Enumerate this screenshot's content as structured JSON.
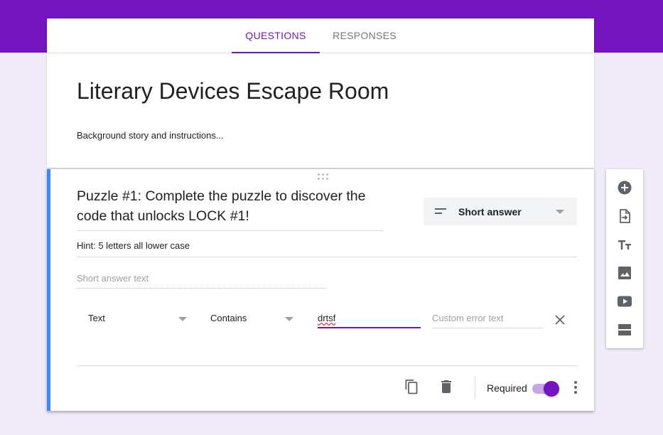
{
  "tabs": {
    "questions": "QUESTIONS",
    "responses": "RESPONSES"
  },
  "form": {
    "title": "Literary Devices Escape Room",
    "description": "Background story and instructions..."
  },
  "question": {
    "title": "Puzzle #1:  Complete the puzzle to discover the code that unlocks LOCK #1!",
    "type_label": "Short answer",
    "hint": "Hint:  5 letters all lower case",
    "answer_placeholder": "Short answer text",
    "validation": {
      "type": "Text",
      "condition": "Contains",
      "value": "drtsf",
      "error_placeholder": "Custom error text"
    },
    "required_label": "Required",
    "required": true
  },
  "toolbar": {
    "icons": [
      "add-question-icon",
      "import-questions-icon",
      "add-title-icon",
      "add-image-icon",
      "add-video-icon",
      "add-section-icon"
    ]
  },
  "colors": {
    "accent": "#7314c0",
    "background": "#f0ebf8",
    "active_border": "#4285f4"
  }
}
